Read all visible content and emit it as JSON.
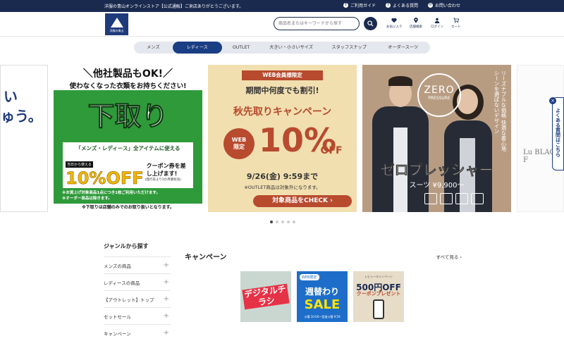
{
  "topbar": {
    "notice": "洋服の青山オンラインストア【公式通販】ご来店ありがとうございます。",
    "links": [
      "ご利用ガイド",
      "よくある質問",
      "お問い合わせ"
    ]
  },
  "header": {
    "logo_text": "洋服の青山",
    "search_placeholder": "商品名またはキーワードから探す",
    "nav": [
      "お気に入り",
      "店舗検索",
      "ログイン",
      "カート"
    ]
  },
  "category_nav": {
    "items": [
      "メンズ",
      "レディース",
      "OUTLET",
      "大きい・小さいサイズ",
      "スタッフスナップ",
      "オーダースーツ"
    ],
    "active_index": 1
  },
  "banners": {
    "left_partial": {
      "line1": "い",
      "line2": "ゅう。"
    },
    "trade_in": {
      "line1": "＼他社製品もOK!／",
      "line2": "使わなくなった衣類をお持ちください!",
      "big": "下取り",
      "box_sub": "「メンズ・レディース」全アイテムに使える",
      "pct": "10%OFF",
      "small_label": "当日から使える",
      "coupon": "クーポン券を差し上げます!",
      "validity": "(発行日より3か月間有効)",
      "note1": "※お買上げ対象商品1点につき1枚ご利用いただけます。",
      "note2": "※オーダー商品は除きます。",
      "bottom": "※下取りは店舗のみでのお取り扱いとなります。"
    },
    "web_sale": {
      "ribbon": "WEB会員様限定",
      "line1": "期間中何度でも割引!",
      "line2": "秋先取りキャンペーン",
      "circle1": "WEB",
      "circle2": "限定",
      "pct": "10%",
      "off": "OFF",
      "date": "9/26(金) 9:59まで",
      "sub": "※OUTLET商品は対象外になります。",
      "button": "対象商品をCHECK ›"
    },
    "zero_pressure": {
      "logo1": "ZERO",
      "logo2": "PRESSURE",
      "tagline": "リーズナブルな価格 快適な着心地 シーンを選ばないデザイン",
      "title": "ゼロプレッシャー",
      "price": "スーツ ¥9,900～"
    },
    "right_partial": {
      "text": "Lu BLACK F"
    }
  },
  "carousel": {
    "count": 5,
    "active": 0
  },
  "side_tab": {
    "label": "よくある質問はこちら",
    "close": "×"
  },
  "genre": {
    "title": "ジャンルから探す",
    "items": [
      "メンズの商品",
      "レディースの商品",
      "【アウトレット】トップ",
      "セットセール",
      "キャンペーン"
    ]
  },
  "campaign": {
    "title": "キャンペーン",
    "more": "すべて見る ›",
    "thumb1": {
      "text": "デジタルチラシ"
    },
    "thumb2": {
      "ribbon": "WEB限定",
      "line1": "週替わり",
      "line2": "SALE",
      "period": "火曜 10:00～翌週火曜 9:59"
    },
    "thumb3": {
      "head": "レビューキャンペーン",
      "amount": "500円OFF",
      "label": "クーポンプレゼント"
    }
  },
  "colors": {
    "navy": "#1a2a4f",
    "accent_blue": "#1a3e84",
    "green": "#2f9a3a",
    "rust": "#b84a2e"
  }
}
